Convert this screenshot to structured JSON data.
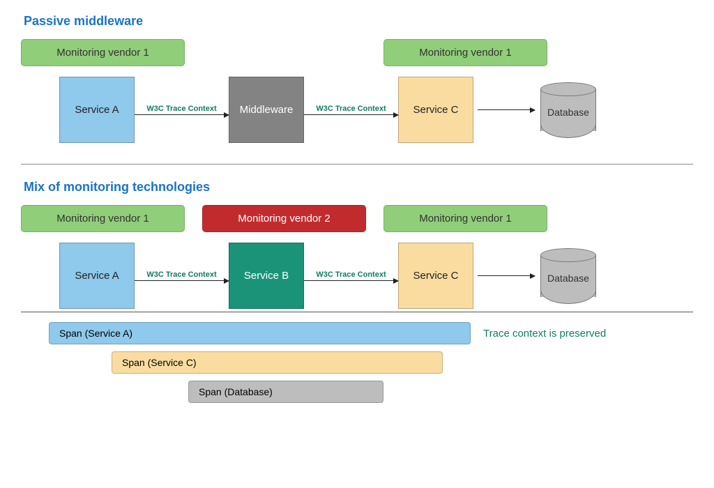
{
  "section1": {
    "title": "Passive middleware",
    "vendors": {
      "left": "Monitoring vendor 1",
      "right": "Monitoring vendor 1"
    },
    "nodes": {
      "serviceA": "Service A",
      "middleware": "Middleware",
      "serviceC": "Service C",
      "database": "Database"
    },
    "arrows": {
      "a_to_mw": "W3C Trace Context",
      "mw_to_c": "W3C Trace Context"
    }
  },
  "section2": {
    "title": "Mix of monitoring technologies",
    "vendors": {
      "left": "Monitoring vendor 1",
      "mid": "Monitoring vendor 2",
      "right": "Monitoring vendor 1"
    },
    "nodes": {
      "serviceA": "Service A",
      "serviceB": "Service B",
      "serviceC": "Service C",
      "database": "Database"
    },
    "arrows": {
      "a_to_b": "W3C Trace Context",
      "b_to_c": "W3C Trace Context"
    },
    "spans": {
      "a": "Span (Service A)",
      "c": "Span (Service C)",
      "db": "Span (Database)"
    },
    "annotation": "Trace context is preserved"
  }
}
